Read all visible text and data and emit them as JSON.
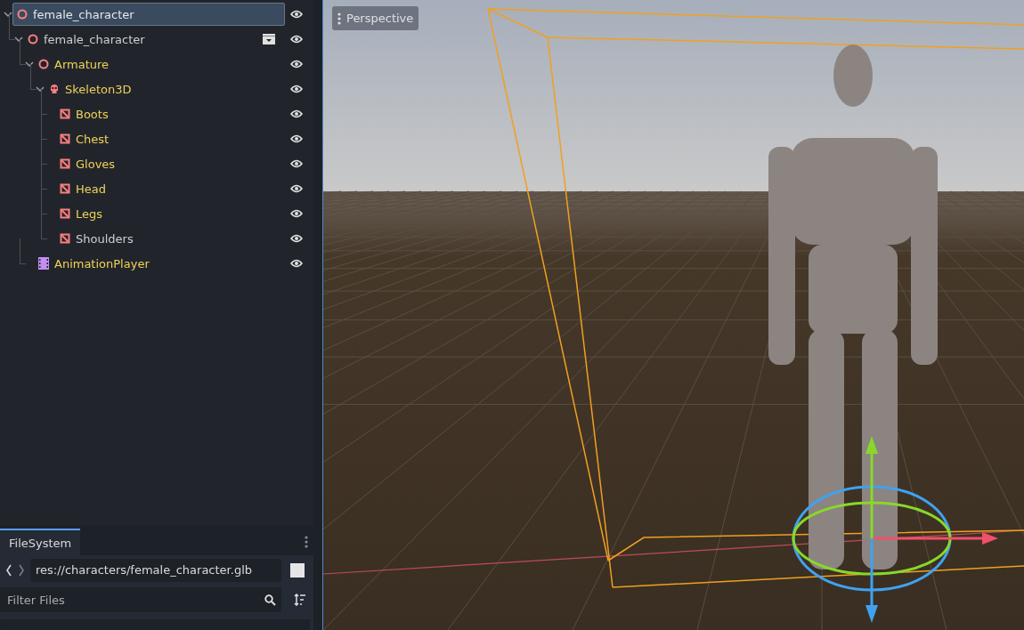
{
  "scene_tree": {
    "nodes": [
      {
        "name": "female_character",
        "kind": "node3d",
        "selected": true,
        "from_scene": false,
        "expanded": true,
        "scene_badge": false,
        "children": [
          {
            "name": "female_character",
            "kind": "node3d",
            "selected": false,
            "from_scene": false,
            "expanded": true,
            "scene_badge": true,
            "children": [
              {
                "name": "Armature",
                "kind": "node3d",
                "selected": false,
                "from_scene": true,
                "expanded": true,
                "scene_badge": false,
                "children": [
                  {
                    "name": "Skeleton3D",
                    "kind": "skeleton",
                    "selected": false,
                    "from_scene": true,
                    "expanded": true,
                    "scene_badge": false,
                    "children": [
                      {
                        "name": "Boots",
                        "kind": "mesh",
                        "selected": false,
                        "from_scene": true,
                        "scene_badge": false
                      },
                      {
                        "name": "Chest",
                        "kind": "mesh",
                        "selected": false,
                        "from_scene": true,
                        "scene_badge": false
                      },
                      {
                        "name": "Gloves",
                        "kind": "mesh",
                        "selected": false,
                        "from_scene": true,
                        "scene_badge": false
                      },
                      {
                        "name": "Head",
                        "kind": "mesh",
                        "selected": false,
                        "from_scene": true,
                        "scene_badge": false
                      },
                      {
                        "name": "Legs",
                        "kind": "mesh",
                        "selected": false,
                        "from_scene": true,
                        "scene_badge": false
                      },
                      {
                        "name": "Shoulders",
                        "kind": "mesh",
                        "selected": false,
                        "from_scene": false,
                        "scene_badge": false
                      }
                    ]
                  }
                ]
              },
              {
                "name": "AnimationPlayer",
                "kind": "animation",
                "selected": false,
                "from_scene": true,
                "scene_badge": false
              }
            ]
          }
        ]
      }
    ]
  },
  "filesystem": {
    "tab": "FileSystem",
    "path": "res://characters/female_character.glb",
    "filter": {
      "placeholder": "Filter Files"
    }
  },
  "viewport": {
    "view_menu": "Perspective"
  }
}
